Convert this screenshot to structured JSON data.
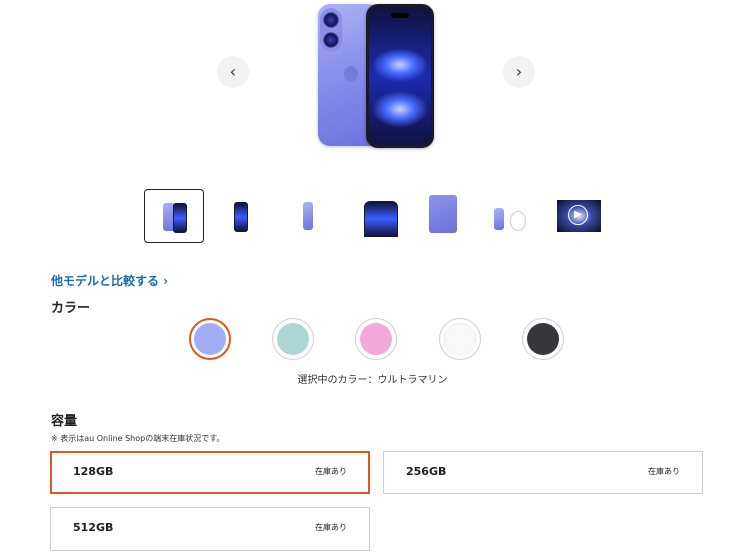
{
  "gallery": {
    "prev_icon": "chevron-left-icon",
    "next_icon": "chevron-right-icon",
    "prev_glyph": "‹",
    "next_glyph": "›",
    "selected_thumbnail": 1,
    "thumbnail_count": 7
  },
  "compare_link": "他モデルと比較する ›",
  "color_section": {
    "title": "カラー",
    "swatches": [
      {
        "color": "#a3adf6",
        "selected": true
      },
      {
        "color": "#abd6d3",
        "selected": false
      },
      {
        "color": "#f2a8d8",
        "selected": false
      },
      {
        "color": "#f9f9f9",
        "selected": false
      },
      {
        "color": "#35373b",
        "selected": false
      }
    ],
    "selected_text": "選択中のカラー：ウルトラマリン"
  },
  "capacity_section": {
    "title": "容量",
    "note": "※ 表示はau Online Shopの端末在庫状況です。",
    "options": [
      {
        "capacity": "128GB",
        "stock": "在庫あり",
        "selected": true
      },
      {
        "capacity": "256GB",
        "stock": "在庫あり",
        "selected": false
      },
      {
        "capacity": "512GB",
        "stock": "在庫あり",
        "selected": false
      }
    ]
  },
  "colors": {
    "accent": "#e0571a",
    "link": "#1a6db3",
    "border": "#cfcfcf"
  }
}
